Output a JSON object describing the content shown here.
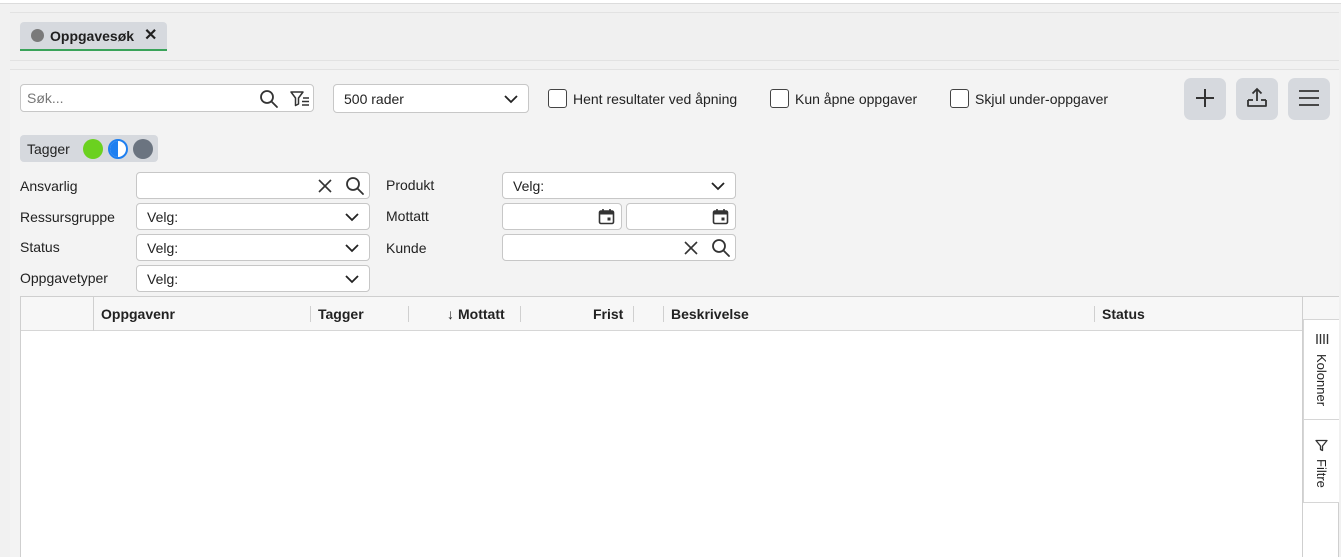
{
  "tabs": [
    {
      "label": "Oppgavesøk",
      "close": "✕"
    }
  ],
  "toolbar": {
    "search_placeholder": "Søk...",
    "rows_select": "500 rader",
    "checkboxes": [
      {
        "label": "Hent resultater ved åpning",
        "checked": false
      },
      {
        "label": "Kun åpne oppgaver",
        "checked": false
      },
      {
        "label": "Skjul under-oppgaver",
        "checked": false
      }
    ],
    "icons": [
      "plus-icon",
      "export-icon",
      "menu-icon"
    ]
  },
  "tags": {
    "label": "Tagger",
    "colors": [
      "#6bd11f",
      "#1e7ff0",
      "#6b7480"
    ]
  },
  "filters": {
    "ansvarlig": {
      "label": "Ansvarlig",
      "value": ""
    },
    "ressursgruppe": {
      "label": "Ressursgruppe",
      "value": "Velg:"
    },
    "status": {
      "label": "Status",
      "value": "Velg:"
    },
    "oppgavetyper": {
      "label": "Oppgavetyper",
      "value": "Velg:"
    },
    "produkt": {
      "label": "Produkt",
      "value": "Velg:"
    },
    "mottatt": {
      "label": "Mottatt",
      "from": "",
      "to": ""
    },
    "kunde": {
      "label": "Kunde",
      "value": ""
    }
  },
  "grid": {
    "columns": [
      {
        "label": "Oppgavenr"
      },
      {
        "label": "Tagger"
      },
      {
        "label": "Mottatt",
        "sort": "↓"
      },
      {
        "label": "Frist"
      },
      {
        "label": "Beskrivelse"
      },
      {
        "label": "Status"
      }
    ],
    "rows": []
  },
  "side_panel": {
    "columns_label": "Kolonner",
    "filters_label": "Filtre"
  }
}
